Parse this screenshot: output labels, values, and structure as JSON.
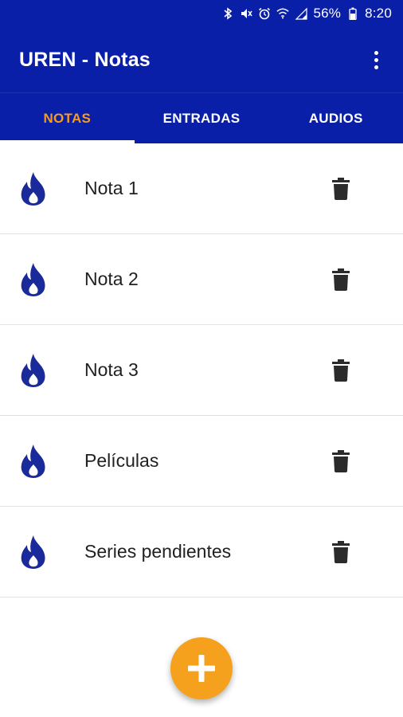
{
  "status_bar": {
    "battery_text": "56%",
    "time": "8:20",
    "icons": [
      "bluetooth-icon",
      "mute-icon",
      "alarm-icon",
      "wifi-icon",
      "signal-icon",
      "battery-icon"
    ]
  },
  "app_bar": {
    "title": "UREN - Notas",
    "overflow_icon": "more-vert-icon"
  },
  "tabs": [
    {
      "label": "NOTAS",
      "active": true
    },
    {
      "label": "ENTRADAS",
      "active": false
    },
    {
      "label": "AUDIOS",
      "active": false
    }
  ],
  "notes": [
    {
      "label": "Nota 1",
      "icon": "flame-icon",
      "action_icon": "trash-icon"
    },
    {
      "label": "Nota 2",
      "icon": "flame-icon",
      "action_icon": "trash-icon"
    },
    {
      "label": "Nota 3",
      "icon": "flame-icon",
      "action_icon": "trash-icon"
    },
    {
      "label": "Películas",
      "icon": "flame-icon",
      "action_icon": "trash-icon"
    },
    {
      "label": "Series pendientes",
      "icon": "flame-icon",
      "action_icon": "trash-icon"
    }
  ],
  "fab": {
    "icon": "plus-icon"
  },
  "colors": {
    "primary": "#0a1fa8",
    "accent": "#f59a23",
    "fab": "#f6a11d",
    "flame": "#1a2a9a"
  }
}
